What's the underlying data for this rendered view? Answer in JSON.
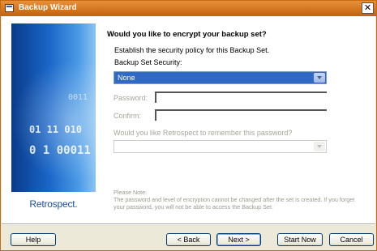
{
  "window": {
    "title": "Backup Wizard"
  },
  "sidebar": {
    "binary_1": "0011",
    "binary_2": "01 11 010",
    "binary_3": "0 1 00011",
    "logo_text": "Retrospect."
  },
  "main": {
    "heading": "Would you like to encrypt your backup set?",
    "intro": "Establish the security policy for this Backup Set.",
    "security_label": "Backup Set Security:",
    "security_value": "None",
    "password_label": "Password:",
    "confirm_label": "Confirm:",
    "remember_label": "Would you like Retrospect to remember this password?",
    "note_title": "Please Note:",
    "note_line1": "The password and level of encryption cannot be changed after the set is created. If you forget",
    "note_line2": "your password, you will not be able to access the Backup Set."
  },
  "buttons": {
    "help": "Help",
    "back": "< Back",
    "next": "Next >",
    "start_now": "Start Now",
    "cancel": "Cancel"
  },
  "icons": {
    "close": "close-icon",
    "app": "app-icon",
    "dropdown": "chevron-down-icon"
  }
}
